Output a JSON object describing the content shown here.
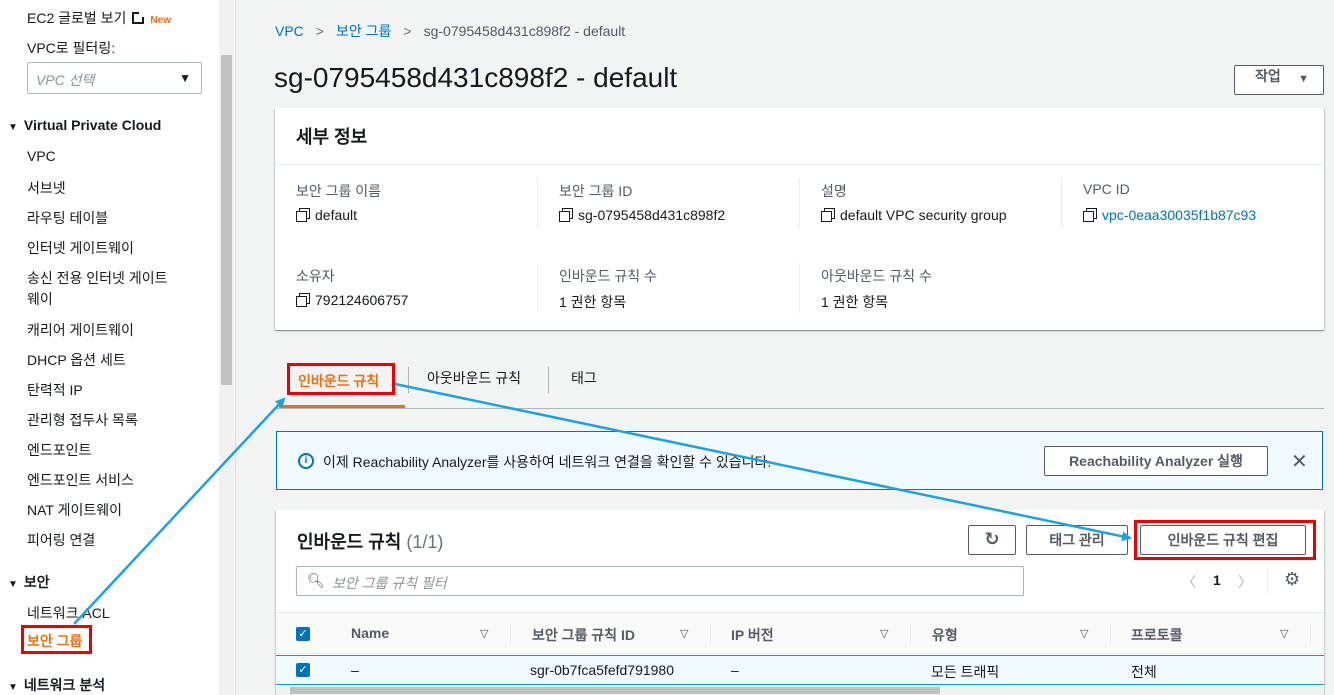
{
  "sidebar": {
    "global_view": "EC2 글로벌 보기",
    "new_badge": "New",
    "filter_label": "VPC로 필터링:",
    "vpc_select_placeholder": "VPC 선택",
    "section_vpc": "Virtual Private Cloud",
    "vpc_items": [
      "VPC",
      "서브넷",
      "라우팅 테이블",
      "인터넷 게이트웨이",
      "송신 전용 인터넷 게이트",
      "웨이",
      "캐리어 게이트웨이",
      "DHCP 옵션 세트",
      "탄력적 IP",
      "관리형 접두사 목록",
      "엔드포인트",
      "엔드포인트 서비스",
      "NAT 게이트웨이",
      "피어링 연결"
    ],
    "section_security": "보안",
    "security_items": [
      "네트워크 ACL",
      "보안 그룹"
    ],
    "section_network_analysis": "네트워크 분석"
  },
  "breadcrumb": {
    "root": "VPC",
    "parent": "보안 그룹",
    "current": "sg-0795458d431c898f2 - default"
  },
  "page": {
    "title": "sg-0795458d431c898f2 - default",
    "actions_label": "작업"
  },
  "details": {
    "header": "세부 정보",
    "fields": {
      "sg_name_label": "보안 그룹 이름",
      "sg_name_value": "default",
      "sg_id_label": "보안 그룹 ID",
      "sg_id_value": "sg-0795458d431c898f2",
      "desc_label": "설명",
      "desc_value": "default VPC security group",
      "vpc_id_label": "VPC ID",
      "vpc_id_value": "vpc-0eaa30035f1b87c93",
      "owner_label": "소유자",
      "owner_value": "792124606757",
      "inbound_count_label": "인바운드 규칙 수",
      "inbound_count_value": "1 권한 항목",
      "outbound_count_label": "아웃바운드 규칙 수",
      "outbound_count_value": "1 권한 항목"
    }
  },
  "tabs": {
    "inbound": "인바운드 규칙",
    "outbound": "아웃바운드 규칙",
    "tags": "태그"
  },
  "info_banner": {
    "text": "이제 Reachability Analyzer를 사용하여 네트워크 연결을 확인할 수 있습니다.",
    "button": "Reachability Analyzer 실행"
  },
  "rules": {
    "title": "인바운드 규칙",
    "count": "(1/1)",
    "manage_tags": "태그 관리",
    "edit_button": "인바운드 규칙 편집",
    "search_placeholder": "보안 그룹 규칙 필터",
    "page_number": "1",
    "columns": [
      "Name",
      "보안 그룹 규칙 ID",
      "IP 버전",
      "유형",
      "프로토콜"
    ],
    "row": {
      "name": "–",
      "rule_id": "sgr-0b7fca5fefd791980",
      "ip_version": "–",
      "type": "모든 트래픽",
      "protocol": "전체"
    }
  },
  "colors": {
    "accent_orange": "#ec7211",
    "link_blue": "#0073bb",
    "annotation_red": "#ee0000",
    "annotation_arrow": "#1aa3e0"
  }
}
